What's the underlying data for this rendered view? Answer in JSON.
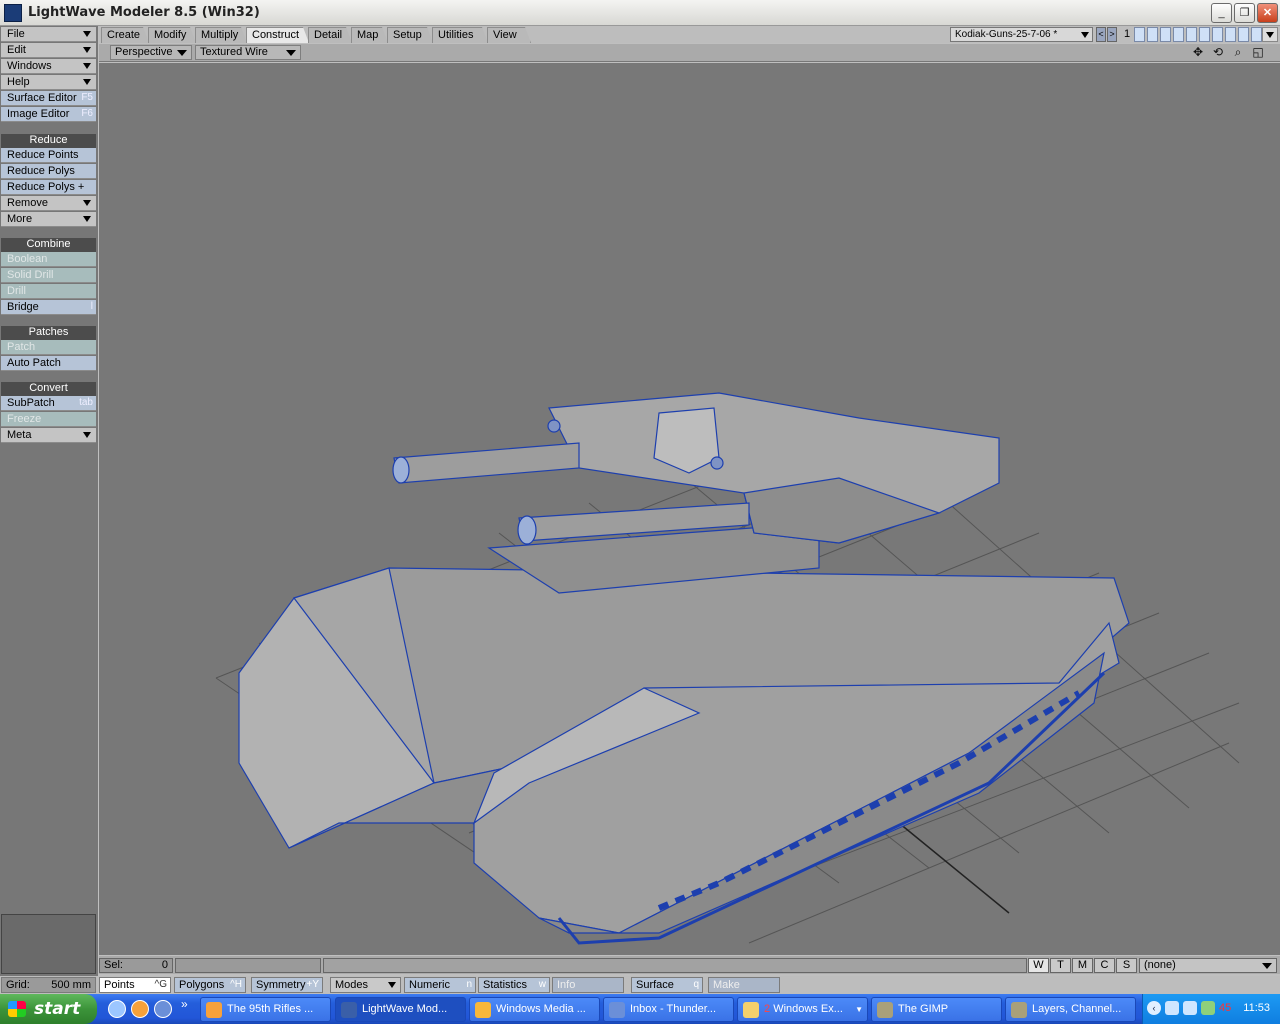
{
  "window": {
    "title": "LightWave Modeler 8.5 (Win32)",
    "minimize": "_",
    "restore": "❐",
    "close": "✕"
  },
  "menubar": {
    "tabs": [
      {
        "label": "Create",
        "active": false
      },
      {
        "label": "Modify",
        "active": false
      },
      {
        "label": "Multiply",
        "active": false
      },
      {
        "label": "Construct",
        "active": true
      },
      {
        "label": "Detail",
        "active": false
      },
      {
        "label": "Map",
        "active": false
      },
      {
        "label": "Setup",
        "active": false
      },
      {
        "label": "Utilities",
        "active": false
      },
      {
        "label": "View",
        "active": false
      }
    ],
    "scene": "Kodiak-Guns-25-7-06 *",
    "prev": "<",
    "next": ">",
    "layer_number": "1"
  },
  "viewbar": {
    "view": "Perspective",
    "render": "Textured Wire"
  },
  "toolbar": {
    "file": "File",
    "edit": "Edit",
    "windows": "Windows",
    "help": "Help",
    "surface_editor": "Surface Editor",
    "surface_key": "F5",
    "image_editor": "Image Editor",
    "image_key": "F6",
    "reduce": "Reduce",
    "reduce_points": "Reduce Points",
    "reduce_polys": "Reduce Polys",
    "reduce_polys_plus": "Reduce Polys +",
    "remove": "Remove",
    "more": "More",
    "combine": "Combine",
    "boolean": "Boolean",
    "solid_drill": "Solid Drill",
    "drill": "Drill",
    "bridge": "Bridge",
    "bridge_key": "l",
    "patches": "Patches",
    "patch": "Patch",
    "auto_patch": "Auto Patch",
    "convert": "Convert",
    "subpatch": "SubPatch",
    "subpatch_key": "tab",
    "freeze": "Freeze",
    "meta": "Meta"
  },
  "status": {
    "sel_label": "Sel:",
    "sel_value": "0",
    "wtmcs": [
      "W",
      "T",
      "M",
      "C",
      "S"
    ],
    "surface_value": "(none)"
  },
  "bottom": {
    "grid_label": "Grid:",
    "grid_value": "500 mm",
    "points": "Points",
    "points_key": "^G",
    "polygons": "Polygons",
    "polygons_key": "^H",
    "symmetry": "Symmetry",
    "symmetry_key": "+Y",
    "modes": "Modes",
    "numeric": "Numeric",
    "numeric_key": "n",
    "statistics": "Statistics",
    "statistics_key": "w",
    "info": "Info",
    "surface": "Surface",
    "surface_key": "q",
    "make": "Make"
  },
  "taskbar": {
    "start": "start",
    "more": "»",
    "tasks": [
      {
        "label": "The 95th Rifles ..."
      },
      {
        "label": "LightWave Mod..."
      },
      {
        "label": "Windows Media ..."
      },
      {
        "label": "Inbox - Thunder..."
      },
      {
        "count": "2",
        "label": "Windows Ex..."
      },
      {
        "label": "The GIMP"
      },
      {
        "label": "Layers, Channel..."
      }
    ],
    "tray_number": "45",
    "clock": "11:53"
  }
}
